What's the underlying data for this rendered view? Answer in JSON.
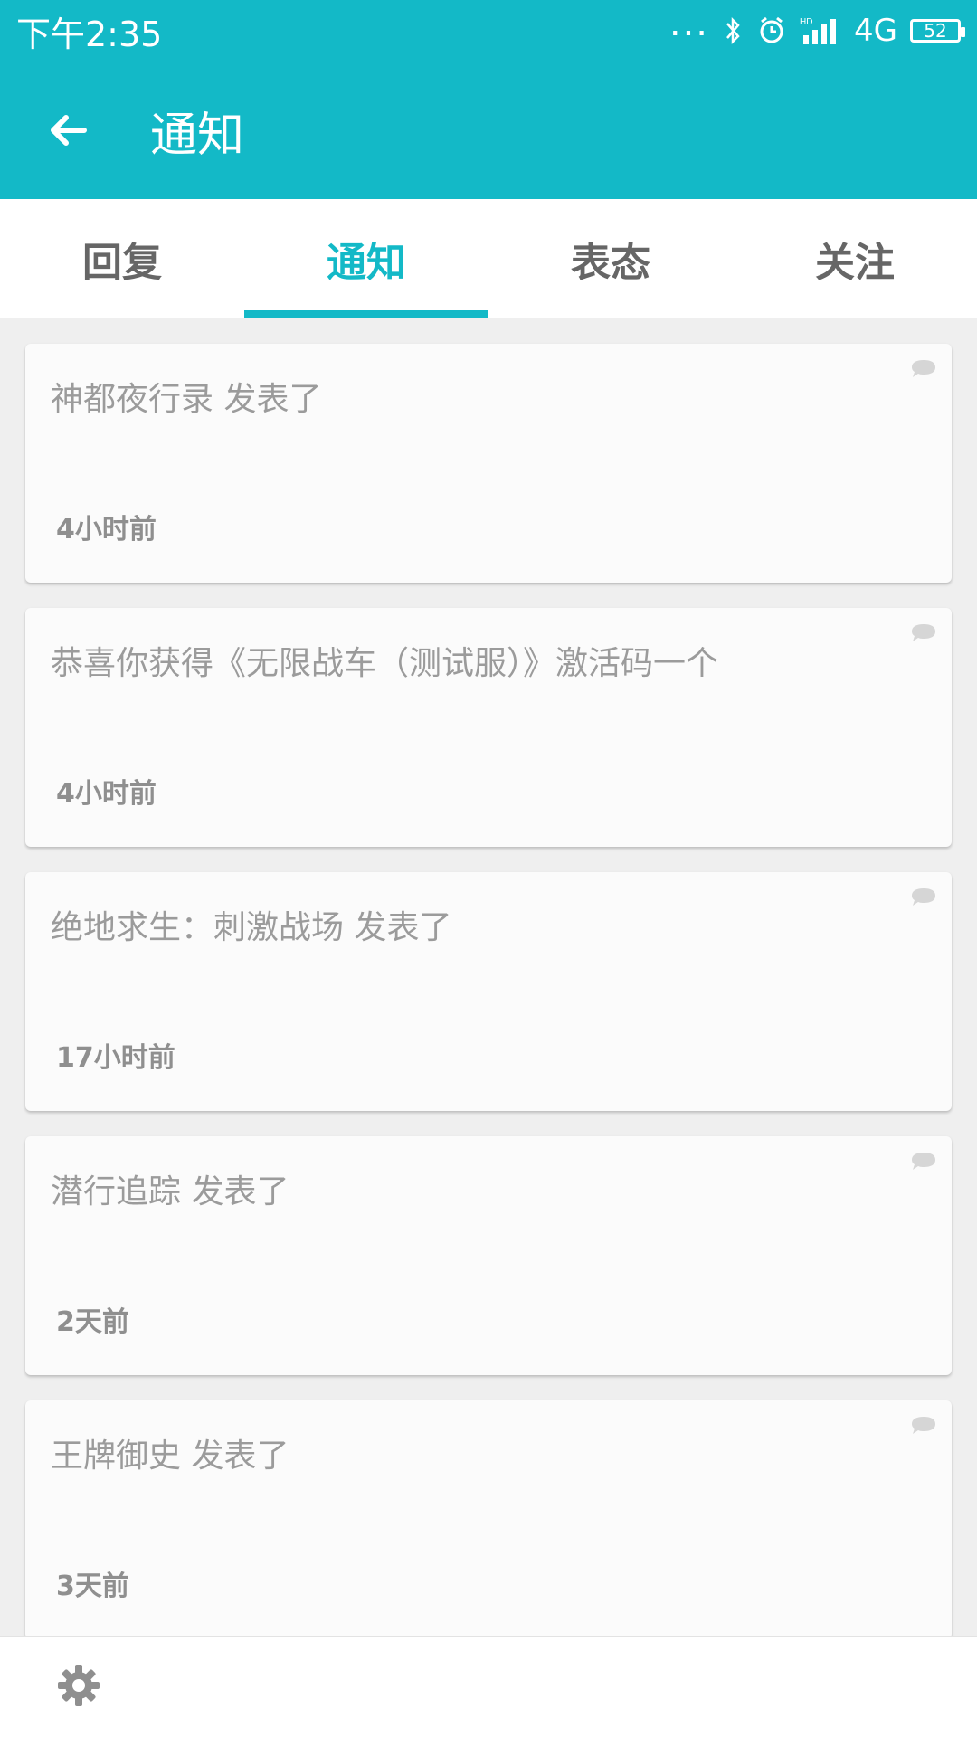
{
  "status_bar": {
    "time": "下午2:35",
    "dots": "...",
    "network": "4G",
    "battery": "52"
  },
  "app_bar": {
    "title": "通知"
  },
  "tabs": [
    {
      "label": "回复",
      "active": false
    },
    {
      "label": "通知",
      "active": true
    },
    {
      "label": "表态",
      "active": false
    },
    {
      "label": "关注",
      "active": false
    }
  ],
  "notifications": [
    {
      "message": "神都夜行录 发表了",
      "time": "4小时前"
    },
    {
      "message": "恭喜你获得《无限战车（测试服）》激活码一个",
      "time": "4小时前"
    },
    {
      "message": "绝地求生：刺激战场 发表了",
      "time": "17小时前"
    },
    {
      "message": "潜行追踪 发表了",
      "time": "2天前"
    },
    {
      "message": "王牌御史 发表了",
      "time": "3天前"
    }
  ],
  "colors": {
    "accent": "#13b9c7",
    "muted_text": "#9b9b9b",
    "background": "#efefef"
  }
}
